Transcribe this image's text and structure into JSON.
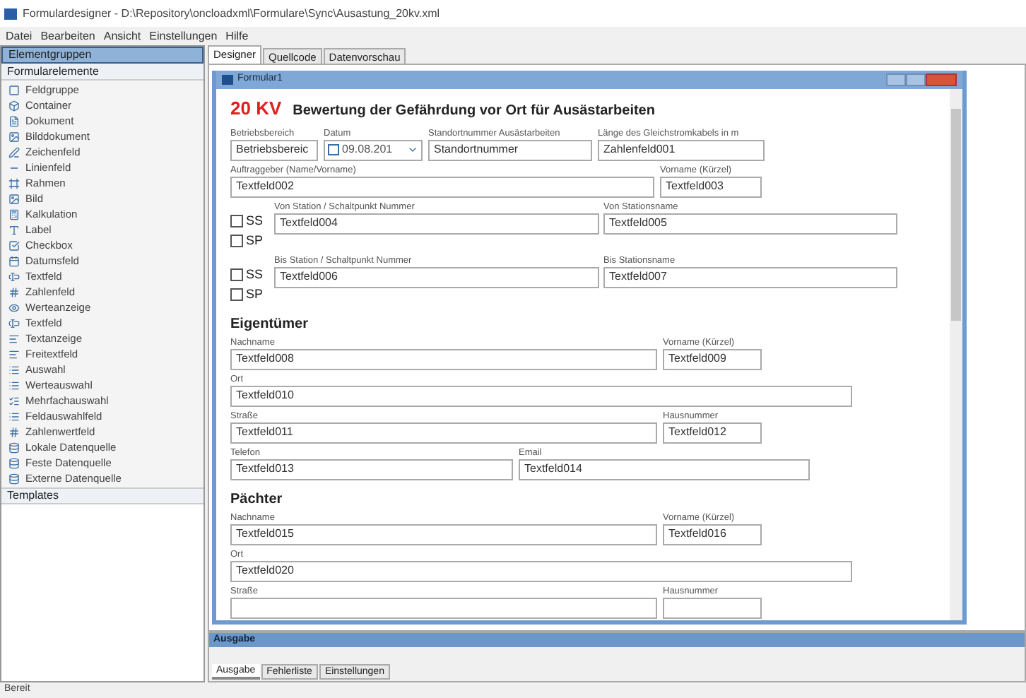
{
  "window": {
    "title": "Formulardesigner - D:\\Repository\\oncloadxml\\Formulare\\Sync\\Ausastung_20kv.xml"
  },
  "menu": [
    "Datei",
    "Bearbeiten",
    "Ansicht",
    "Einstellungen",
    "Hilfe"
  ],
  "sidebar": {
    "groups": [
      {
        "label": "Elementgruppen",
        "selected": true
      },
      {
        "label": "Formularelemente",
        "selected": false
      }
    ],
    "items": [
      "Feldgruppe",
      "Container",
      "Dokument",
      "Bilddokument",
      "Zeichenfeld",
      "Linienfeld",
      "Rahmen",
      "Bild",
      "Kalkulation",
      "Label",
      "Checkbox",
      "Datumsfeld",
      "Textfeld",
      "Zahlenfeld",
      "Werteanzeige",
      "Textfeld",
      "Textanzeige",
      "Freitextfeld",
      "Auswahl",
      "Werteauswahl",
      "Mehrfachauswahl",
      "Feldauswahlfeld",
      "Zahlenwertfeld",
      "Lokale Datenquelle",
      "Feste Datenquelle",
      "Externe Datenquelle"
    ],
    "footer": "Templates"
  },
  "tabs": [
    {
      "label": "Designer",
      "selected": true
    },
    {
      "label": "Quellcode",
      "selected": false
    },
    {
      "label": "Datenvorschau",
      "selected": false
    }
  ],
  "form": {
    "window_title": "Formular1",
    "badge": "20 KV",
    "title": "Bewertung der Gefährdung vor Ort für Ausästarbeiten",
    "rows": [
      {
        "kind": "fields",
        "fields": [
          {
            "label": "Betriebsbereich",
            "value": "Betriebsbereic",
            "kind": "text"
          },
          {
            "label": "Datum",
            "value": "09.08.201",
            "kind": "date",
            "checked": false
          },
          {
            "label": "Standortnummer Ausästarbeiten",
            "value": "Standortnummer",
            "kind": "text"
          },
          {
            "label": "Länge des Gleichstromkabels in m",
            "value": "Zahlenfeld001",
            "kind": "text"
          }
        ]
      },
      {
        "kind": "fields",
        "fields": [
          {
            "label": "Auftraggeber (Name/Vorname)",
            "value": "Textfeld002",
            "kind": "text"
          },
          {
            "label": "Vorname (Kürzel)",
            "value": "Textfeld003",
            "kind": "text"
          }
        ]
      },
      {
        "kind": "stations",
        "checks": [
          {
            "label": "SS",
            "checked": false
          },
          {
            "label": "SP",
            "checked": false
          }
        ],
        "fields": [
          {
            "label": "Von Station / Schaltpunkt Nummer",
            "value": "Textfeld004",
            "kind": "text"
          },
          {
            "label": "Von Stationsname",
            "value": "Textfeld005",
            "kind": "text"
          }
        ]
      },
      {
        "kind": "stations",
        "checks": [
          {
            "label": "SS",
            "checked": false
          },
          {
            "label": "SP",
            "checked": false
          }
        ],
        "fields": [
          {
            "label": "Bis Station / Schaltpunkt Nummer",
            "value": "Textfeld006",
            "kind": "text"
          },
          {
            "label": "Bis Stationsname",
            "value": "Textfeld007",
            "kind": "text"
          }
        ]
      },
      {
        "kind": "heading",
        "text": "Eigentümer"
      },
      {
        "kind": "fields",
        "fields": [
          {
            "label": "Nachname",
            "value": "Textfeld008",
            "kind": "text"
          },
          {
            "label": "Vorname (Kürzel)",
            "value": "Textfeld009",
            "kind": "text"
          }
        ]
      },
      {
        "kind": "fields",
        "fields": [
          {
            "label": "Ort",
            "value": "Textfeld010",
            "kind": "text"
          }
        ]
      },
      {
        "kind": "fields",
        "fields": [
          {
            "label": "Straße",
            "value": "Textfeld011",
            "kind": "text"
          },
          {
            "label": "Hausnummer",
            "value": "Textfeld012",
            "kind": "text"
          }
        ]
      },
      {
        "kind": "fields",
        "fields": [
          {
            "label": "Telefon",
            "value": "Textfeld013",
            "kind": "text"
          },
          {
            "label": "Email",
            "value": "Textfeld014",
            "kind": "text"
          }
        ]
      },
      {
        "kind": "heading",
        "text": "Pächter"
      },
      {
        "kind": "fields",
        "fields": [
          {
            "label": "Nachname",
            "value": "Textfeld015",
            "kind": "text"
          },
          {
            "label": "Vorname (Kürzel)",
            "value": "Textfeld016",
            "kind": "text"
          }
        ]
      },
      {
        "kind": "fields",
        "fields": [
          {
            "label": "Ort",
            "value": "Textfeld020",
            "kind": "text"
          }
        ]
      },
      {
        "kind": "fields",
        "fields": [
          {
            "label": "Straße",
            "kind": "text"
          },
          {
            "label": "Hausnummer",
            "kind": "text"
          }
        ]
      }
    ]
  },
  "output_panel": {
    "title": "Ausgabe",
    "tabs": [
      {
        "label": "Ausgabe",
        "selected": true
      },
      {
        "label": "Fehlerliste",
        "selected": false
      },
      {
        "label": "Einstellungen",
        "selected": false
      }
    ]
  },
  "status_bar": "Bereit"
}
